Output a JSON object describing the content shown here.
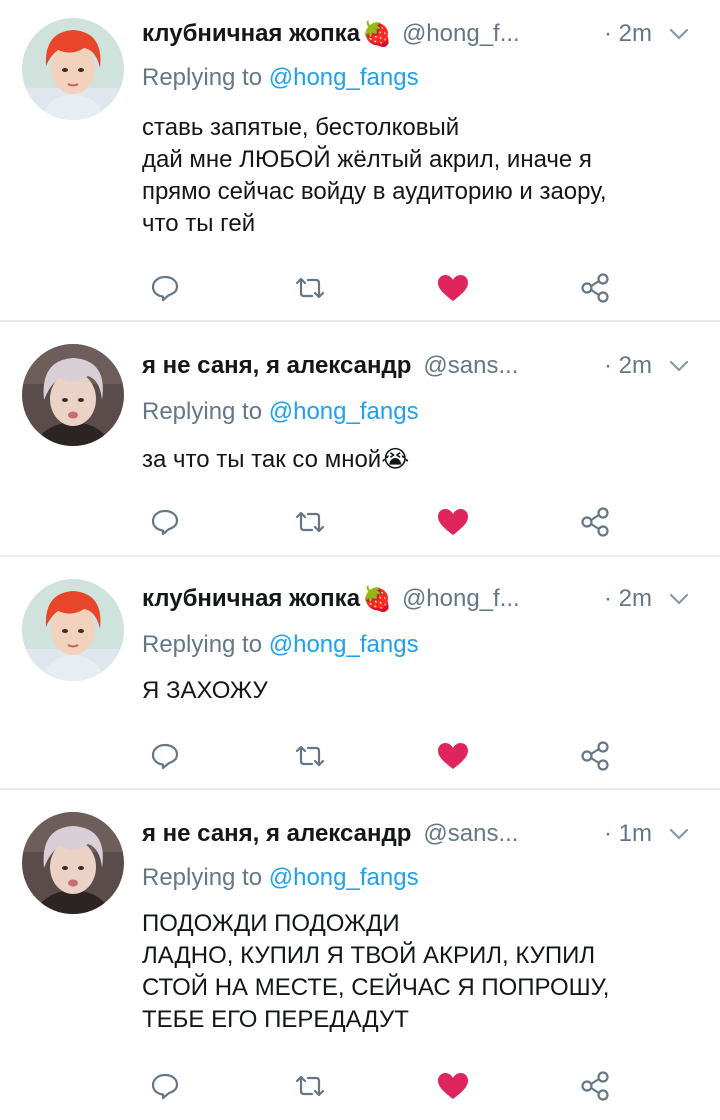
{
  "tweets": [
    {
      "display_name": "клубничная жопка",
      "name_emoji": "🍓",
      "handle": "@hong_f...",
      "time": "· 2m",
      "replying_prefix": "Replying to",
      "replying_to": "@hong_fangs",
      "lines": [
        "ставь запятые, бестолковый",
        "дай мне ЛЮБОЙ жёлтый акрил, иначе я",
        "прямо сейчас войду в аудиторию и заору,",
        "что ты гей"
      ],
      "liked": true,
      "avatar_icon": "red-hair-avatar"
    },
    {
      "display_name": "я не саня, я александр",
      "name_emoji": "",
      "handle": "@sans...",
      "time": "· 2m",
      "replying_prefix": "Replying to",
      "replying_to": "@hong_fangs",
      "lines": [
        "за что ты так со мной😭"
      ],
      "liked": true,
      "avatar_icon": "blonde-hair-avatar"
    },
    {
      "display_name": "клубничная жопка",
      "name_emoji": "🍓",
      "handle": "@hong_f...",
      "time": "· 2m",
      "replying_prefix": "Replying to",
      "replying_to": "@hong_fangs",
      "lines": [
        "Я ЗАХОЖУ"
      ],
      "liked": true,
      "avatar_icon": "red-hair-avatar"
    },
    {
      "display_name": "я не саня, я александр",
      "name_emoji": "",
      "handle": "@sans...",
      "time": "· 1m",
      "replying_prefix": "Replying to",
      "replying_to": "@hong_fangs",
      "lines": [
        "ПОДОЖДИ ПОДОЖДИ",
        "ЛАДНО, КУПИЛ Я ТВОЙ АКРИЛ, КУПИЛ",
        "СТОЙ НА МЕСТЕ, СЕЙЧАС Я ПОПРОШУ,",
        "ТЕБЕ ЕГО ПЕРЕДАДУТ"
      ],
      "liked": true,
      "avatar_icon": "blonde-hair-avatar"
    }
  ],
  "colors": {
    "text": "#14171a",
    "muted": "#657786",
    "mention": "#1da1f2",
    "like": "#e0245e",
    "divider": "#e6ecf0"
  }
}
